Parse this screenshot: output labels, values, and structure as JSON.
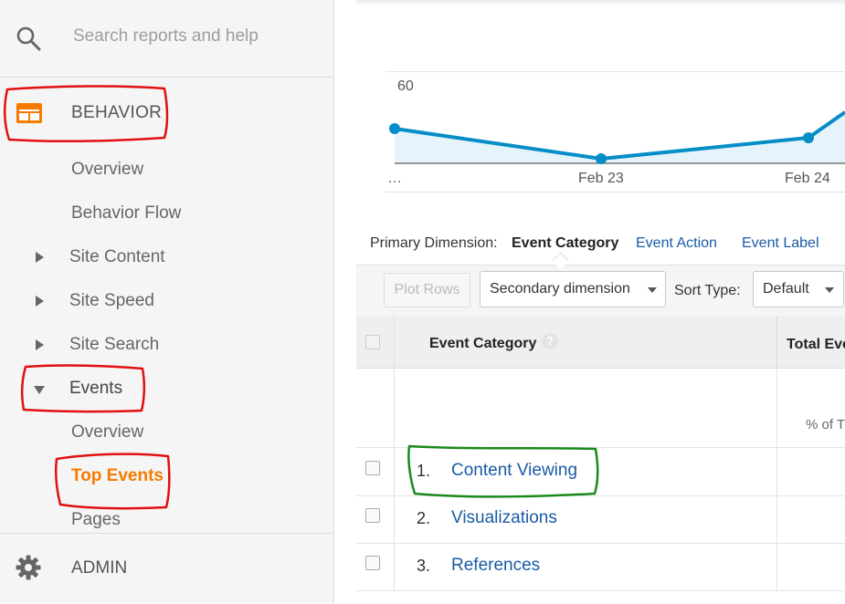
{
  "sidebar": {
    "search_placeholder": "Search reports and help",
    "section_title": "BEHAVIOR",
    "items": [
      {
        "label": "Overview"
      },
      {
        "label": "Behavior Flow"
      },
      {
        "label": "Site Content"
      },
      {
        "label": "Site Speed"
      },
      {
        "label": "Site Search"
      },
      {
        "label": "Events"
      },
      {
        "label": "Overview"
      },
      {
        "label": "Top Events"
      },
      {
        "label": "Pages"
      }
    ],
    "admin_label": "ADMIN",
    "active_color": "#f57c00",
    "icons": [
      "search-icon",
      "behavior-icon",
      "gear-icon"
    ]
  },
  "chart": {
    "y_tick": "60",
    "x_labels": [
      "…",
      "Feb 23",
      "Feb 24"
    ],
    "line_color": "#058dc7",
    "fill_color": "#e5f3fa"
  },
  "dimensions": {
    "label": "Primary Dimension:",
    "active": "Event Category",
    "options": [
      "Event Action",
      "Event Label"
    ]
  },
  "toolbar": {
    "plot_rows": "Plot Rows",
    "secondary_dimension": "Secondary dimension",
    "sort_label": "Sort Type:",
    "sort_value": "Default"
  },
  "table": {
    "col_event_category": "Event Category",
    "help": "?",
    "col_total": "Total Eve",
    "summary_pct": "% of T",
    "rows": [
      {
        "num": "1.",
        "label": "Content Viewing"
      },
      {
        "num": "2.",
        "label": "Visualizations"
      },
      {
        "num": "3.",
        "label": "References"
      }
    ]
  },
  "annotation_colors": {
    "red": "#e01010",
    "green": "#1a8a1a"
  }
}
